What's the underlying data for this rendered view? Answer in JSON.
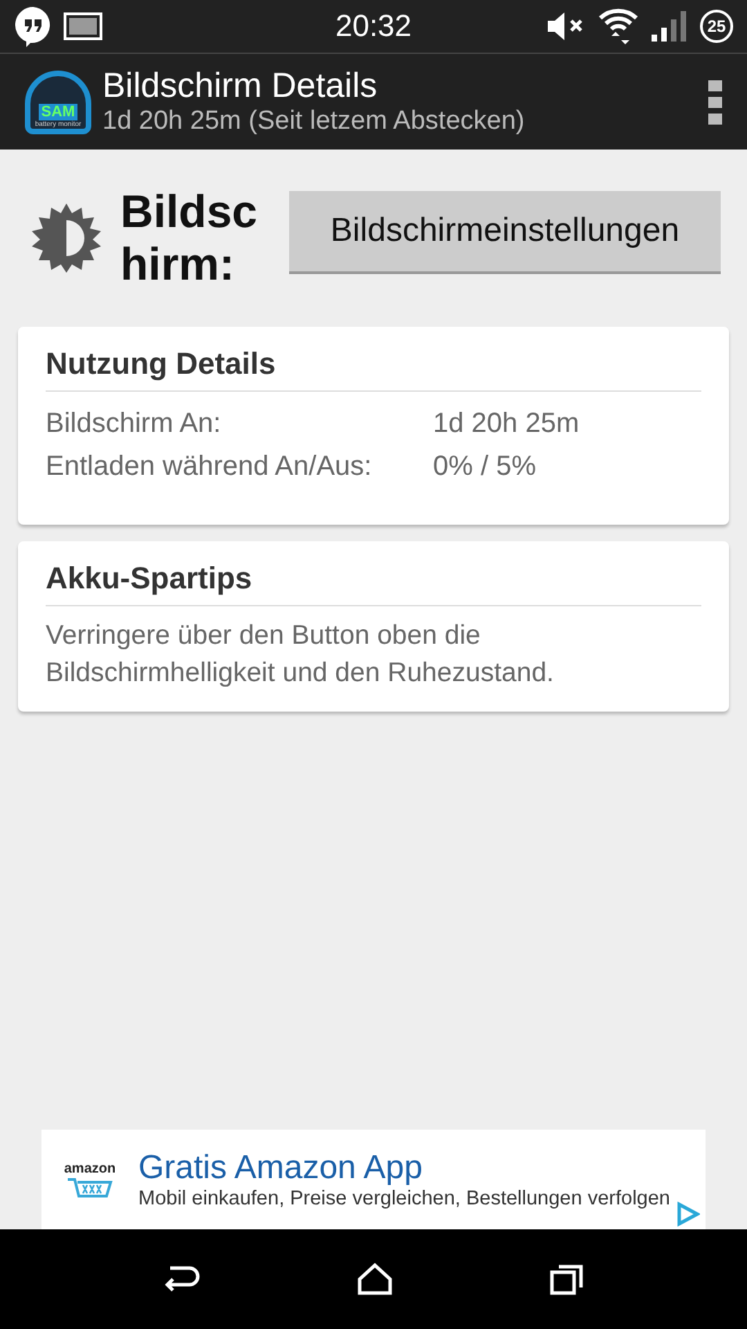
{
  "status_bar": {
    "time": "20:32",
    "battery": "25"
  },
  "action_bar": {
    "logo_text": "SAM",
    "logo_subtext": "battery monitor",
    "title": "Bildschirm Details",
    "subtitle": "1d 20h 25m (Seit letzem Abstecken)"
  },
  "header": {
    "label": "Bildsc hirm:",
    "button": "Bildschirmeinstellungen"
  },
  "usage_card": {
    "title": "Nutzung Details",
    "rows": [
      {
        "label": "Bildschirm An:",
        "value": "1d 20h 25m"
      },
      {
        "label": "Entladen während An/Aus:",
        "value": "0% / 5%"
      }
    ]
  },
  "tips_card": {
    "title": "Akku-Spartips",
    "text": "Verringere über den Button oben die Bildschirmhelligkeit und den Ruhezustand."
  },
  "ad": {
    "logo_text": "amazon",
    "title": "Gratis Amazon App",
    "text": "Mobil einkaufen, Preise vergleichen, Bestellungen verfolgen"
  }
}
